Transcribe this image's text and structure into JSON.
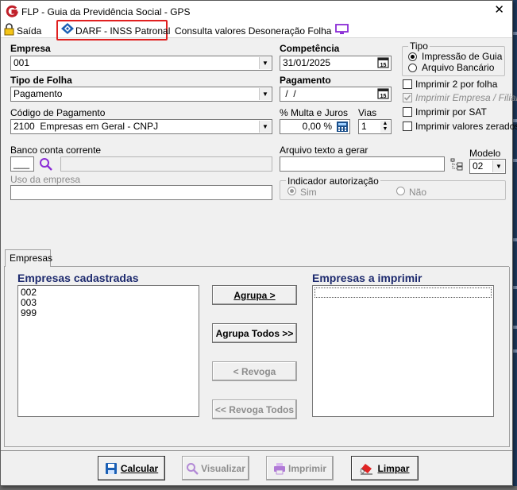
{
  "window": {
    "title": "FLP - Guia da Previdência Social - GPS",
    "close_label": "✕"
  },
  "toolbar": {
    "saida": "Saída",
    "darf": "DARF - INSS Patronal",
    "consulta": "Consulta valores Desoneração Folha"
  },
  "form": {
    "empresa": {
      "label": "Empresa",
      "value": "001"
    },
    "competencia": {
      "label": "Competência",
      "value": "31/01/2025"
    },
    "tipo_folha": {
      "label": "Tipo de Folha",
      "value": "Pagamento"
    },
    "pagamento": {
      "label": "Pagamento",
      "value": " /  /"
    },
    "codigo_pagamento": {
      "label": "Código de Pagamento",
      "value": "2100  Empresas em Geral - CNPJ"
    },
    "multa_juros": {
      "label": "% Multa e Juros",
      "value": "0,00 %"
    },
    "vias": {
      "label": "Vias",
      "value": "1"
    },
    "banco": {
      "label": "Banco conta corrente",
      "value": "___"
    },
    "uso_empresa": {
      "label": "Uso da empresa"
    },
    "arquivo_texto": {
      "label": "Arquivo texto a gerar"
    },
    "modelo": {
      "label": "Modelo",
      "value": "02"
    },
    "indicador": {
      "title": "Indicador autorização",
      "sim": "Sim",
      "nao": "Não"
    },
    "tipo": {
      "title": "Tipo",
      "impressao": "Impressão de Guia",
      "arquivo": "Arquivo Bancário"
    },
    "options": {
      "imprimir2": "Imprimir 2 por folha",
      "imprimir_empresa": "Imprimir Empresa / Filial",
      "imprimir_sat": "Imprimir por SAT",
      "imprimir_zerados": "Imprimir valores zerados"
    }
  },
  "tabs": {
    "empresas": "Empresas"
  },
  "lists": {
    "cadastradas_title": "Empresas cadastradas",
    "cadastradas": [
      "002",
      "003",
      "999"
    ],
    "imprimir_title": "Empresas a imprimir"
  },
  "buttons": {
    "agrupa": "Agrupa >",
    "agrupa_todos": "Agrupa Todos >>",
    "revoga": "< Revoga",
    "revoga_todos": "<< Revoga Todos",
    "calcular": "Calcular",
    "visualizar": "Visualizar",
    "imprimir": "Imprimir",
    "limpar": "Limpar"
  },
  "colors": {
    "highlight": "#e02020",
    "list_header": "#1d2a6e",
    "accent_purple": "#8b2bd6"
  }
}
